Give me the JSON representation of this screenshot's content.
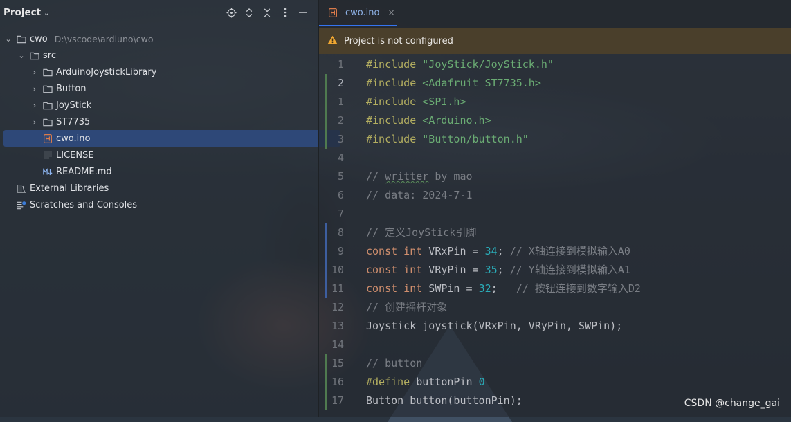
{
  "project_panel": {
    "title": "Project",
    "toolbar": [
      "locate-icon",
      "expand-collapse-icon",
      "collapse-all-icon",
      "more-icon",
      "hide-icon"
    ],
    "tree": [
      {
        "label": "cwo",
        "path": "D:\\vscode\\ardiuno\\cwo",
        "type": "folder",
        "expanded": true
      },
      {
        "label": "src",
        "type": "folder",
        "expanded": true
      },
      {
        "label": "ArduinoJoystickLibrary",
        "type": "folder",
        "expanded": false
      },
      {
        "label": "Button",
        "type": "folder",
        "expanded": false
      },
      {
        "label": "JoyStick",
        "type": "folder",
        "expanded": false
      },
      {
        "label": "ST7735",
        "type": "folder",
        "expanded": false
      },
      {
        "label": "cwo.ino",
        "type": "ino-file",
        "selected": true
      },
      {
        "label": "LICENSE",
        "type": "text-file"
      },
      {
        "label": "README.md",
        "type": "markdown-file"
      },
      {
        "label": "External Libraries",
        "type": "library"
      },
      {
        "label": "Scratches and Consoles",
        "type": "scratches"
      }
    ]
  },
  "editor": {
    "tab": {
      "label": "cwo.ino",
      "close": "×"
    },
    "warning": "Project is not configured",
    "lines": [
      {
        "num": "1",
        "text": "#include \"JoyStick/JoyStick.h\""
      },
      {
        "num": "2",
        "text": "#include <Adafruit_ST7735.h>"
      },
      {
        "num": "1",
        "text": "#include <SPI.h>"
      },
      {
        "num": "2",
        "text": "#include <Arduino.h>"
      },
      {
        "num": "3",
        "text": "#include \"Button/button.h\""
      },
      {
        "num": "4",
        "text": ""
      },
      {
        "num": "5",
        "text": "// writter by mao"
      },
      {
        "num": "6",
        "text": "// data: 2024-7-1"
      },
      {
        "num": "7",
        "text": ""
      },
      {
        "num": "8",
        "text": "// 定义JoyStick引脚"
      },
      {
        "num": "9",
        "text": "const int VRxPin = 34; // X轴连接到模拟输入A0"
      },
      {
        "num": "10",
        "text": "const int VRyPin = 35; // Y轴连接到模拟输入A1"
      },
      {
        "num": "11",
        "text": "const int SWPin = 32;   // 按钮连接到数字输入D2"
      },
      {
        "num": "12",
        "text": "// 创建摇杆对象"
      },
      {
        "num": "13",
        "text": "Joystick joystick(VRxPin, VRyPin, SWPin);"
      },
      {
        "num": "14",
        "text": ""
      },
      {
        "num": "15",
        "text": "// button"
      },
      {
        "num": "16",
        "text": "#define buttonPin 0"
      },
      {
        "num": "17",
        "text": "Button button(buttonPin);"
      }
    ]
  },
  "watermark": "CSDN @change_gai",
  "colors": {
    "accent": "#3574f0",
    "selection": "#2e4878",
    "warning_bg": "#4a3f2b",
    "keyword": "#cf8e6d",
    "string": "#6aab73",
    "number": "#2aacb8",
    "directive": "#b3ae60",
    "comment": "#7a7e85"
  }
}
